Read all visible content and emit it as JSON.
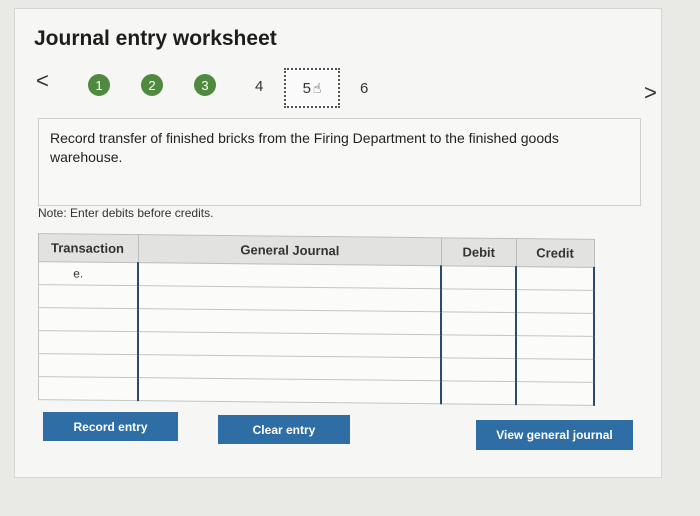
{
  "title": "Journal entry worksheet",
  "nav": {
    "prev": "<",
    "next": ">"
  },
  "steps": [
    "1",
    "2",
    "3",
    "4",
    "5",
    "6"
  ],
  "current_step": "5",
  "prompt": "Record transfer of finished bricks from the Firing Department to the finished goods warehouse.",
  "note": "Note: Enter debits before credits.",
  "table": {
    "headers": {
      "transaction": "Transaction",
      "general_journal": "General Journal",
      "debit": "Debit",
      "credit": "Credit"
    },
    "rows": [
      {
        "transaction": "e.",
        "account": "",
        "debit": "",
        "credit": ""
      },
      {
        "transaction": "",
        "account": "",
        "debit": "",
        "credit": ""
      },
      {
        "transaction": "",
        "account": "",
        "debit": "",
        "credit": ""
      },
      {
        "transaction": "",
        "account": "",
        "debit": "",
        "credit": ""
      },
      {
        "transaction": "",
        "account": "",
        "debit": "",
        "credit": ""
      },
      {
        "transaction": "",
        "account": "",
        "debit": "",
        "credit": ""
      }
    ]
  },
  "buttons": {
    "record": "Record entry",
    "clear": "Clear entry",
    "view": "View general journal"
  },
  "colors": {
    "step_complete": "#4f8a3f",
    "button": "#2f6da5",
    "input_border": "#2c4a6e"
  },
  "icons": {
    "cursor": "hand-pointer-icon"
  }
}
